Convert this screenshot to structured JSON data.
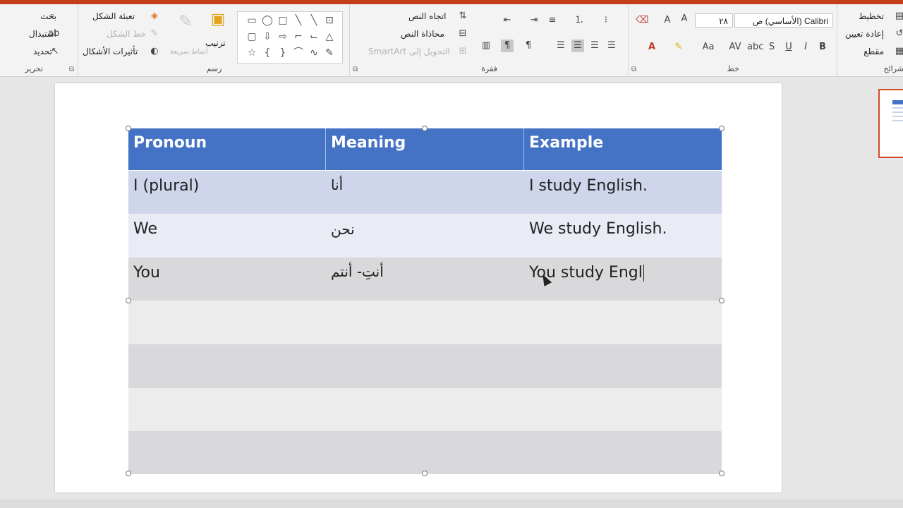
{
  "ribbon": {
    "editing": {
      "group_label": "تحرير",
      "find": "بحث",
      "replace": "استبدال",
      "select": "تحديد"
    },
    "drawing": {
      "group_label": "رسم",
      "shape_fill": "تعبئة الشكل",
      "shape_outline": "خط الشكل",
      "shape_effects": "تأثيرات الأشكال",
      "arrange": "ترتيب",
      "quick_styles": "أنماط سريعة"
    },
    "paragraph": {
      "group_label": "فقرة",
      "text_direction": "اتجاه النص",
      "align_text": "محاذاة النص",
      "convert_smartart": "التحويل إلى SmartArt"
    },
    "font": {
      "group_label": "خط",
      "font_name": "Calibri (الأساسي) ص",
      "font_size": "٢٨"
    },
    "slides": {
      "group_label": "شرائح",
      "layout": "تخطيط",
      "reset": "إعادة تعيين",
      "section": "مقطع"
    }
  },
  "table": {
    "headers": [
      "Pronoun",
      "Meaning",
      "Example"
    ],
    "rows": [
      [
        "I (plural)",
        "أنا",
        "I study English."
      ],
      [
        "We",
        "نحن",
        "We study English."
      ],
      [
        "You",
        "أنتِ- أنتم",
        "You study Engl"
      ]
    ],
    "empty_rows": 4
  },
  "colors": {
    "header": "#4472c4",
    "row_dark": "#cfd5ea",
    "row_light": "#e9ebf5",
    "ribbon_bg": "#f3f3f3",
    "accent": "#c43e1c"
  }
}
